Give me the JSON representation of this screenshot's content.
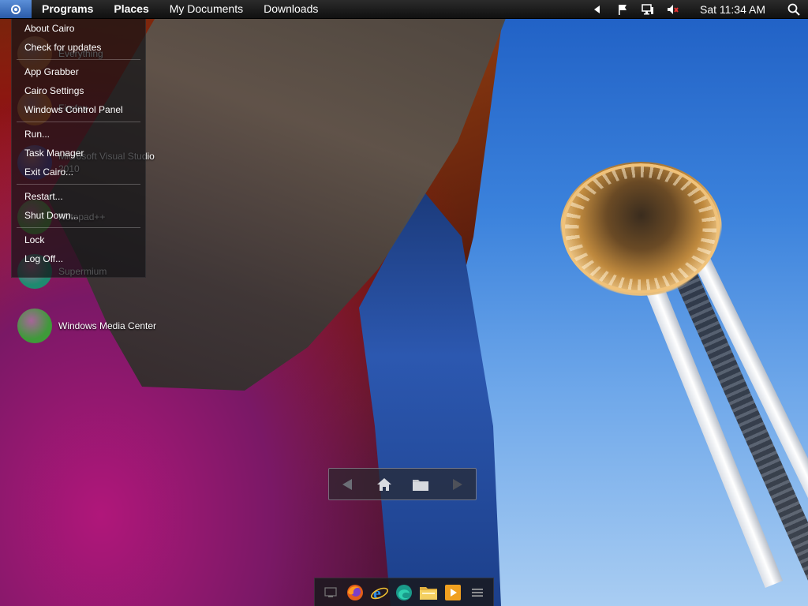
{
  "menubar": {
    "items": [
      {
        "label": "Programs",
        "bold": true
      },
      {
        "label": "Places",
        "bold": true
      },
      {
        "label": "My Documents",
        "bold": false
      },
      {
        "label": "Downloads",
        "bold": false
      }
    ],
    "clock": "Sat 11:34 AM",
    "accent": "#3a6fc0"
  },
  "cairo_menu": {
    "groups": [
      [
        "About Cairo",
        "Check for updates"
      ],
      [
        "App Grabber",
        "Cairo Settings",
        "Windows Control Panel"
      ],
      [
        "Run...",
        "Task Manager",
        "Exit Cairo..."
      ],
      [
        "Restart...",
        "Shut Down..."
      ],
      [
        "Lock",
        "Log Off..."
      ]
    ]
  },
  "desktop_icons": [
    {
      "label": "Everything",
      "icon": "everything-icon",
      "color": "#c85a20"
    },
    {
      "label": "Firefox",
      "icon": "firefox-icon",
      "color": "#e0601c"
    },
    {
      "label": "Microsoft Visual Studio 2010",
      "icon": "visual-studio-icon",
      "color": "#5b3a9a"
    },
    {
      "label": "Notepad++",
      "icon": "notepadpp-icon",
      "color": "#5a9a3a"
    },
    {
      "label": "Supermium",
      "icon": "supermium-icon",
      "color": "#1f8a70"
    },
    {
      "label": "Windows Media Center",
      "icon": "windows-media-center-icon",
      "color": "#3f9a3a"
    }
  ],
  "tray": {
    "icons": [
      "chevron-left-icon",
      "flag-icon",
      "network-icon",
      "volume-muted-icon"
    ]
  },
  "dock": {
    "apps": [
      "desktop-icon",
      "firefox-icon",
      "internet-explorer-icon",
      "edge-icon",
      "file-explorer-icon",
      "media-player-icon"
    ],
    "menu_icon": "hamburger-icon"
  }
}
